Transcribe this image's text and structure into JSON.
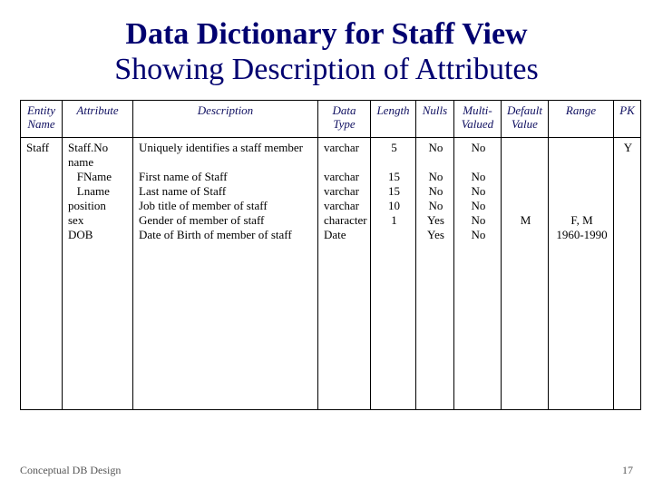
{
  "title": {
    "line1": "Data Dictionary for Staff View",
    "line2": "Showing Description of Attributes"
  },
  "columns": {
    "c0": "Entity Name",
    "c1": "Attribute",
    "c2": "Description",
    "c3": "Data Type",
    "c4": "Length",
    "c5": "Nulls",
    "c6": "Multi-Valued",
    "c7": "Default Value",
    "c8": "Range",
    "c9": "PK"
  },
  "row": {
    "entity": "Staff",
    "attribute": "Staff.No\nname\n   FName\n   Lname\nposition\nsex\nDOB",
    "description": "Uniquely identifies a staff member\n\nFirst name of Staff\nLast name of Staff\nJob title of member of staff\nGender of member of staff\nDate of Birth of member of staff",
    "datatype": "varchar\n\nvarchar\nvarchar\nvarchar\ncharacter\nDate",
    "length": "5\n\n15\n15\n10\n1",
    "nulls": "No\n\nNo\nNo\nNo\nYes\nYes",
    "multi": "No\n\nNo\nNo\nNo\nNo\nNo",
    "default": "\n\n\n\n\nM",
    "range": "\n\n\n\n\nF, M\n1960-1990",
    "pk": "Y"
  },
  "footer": {
    "left": "Conceptual DB Design",
    "right": "17"
  }
}
